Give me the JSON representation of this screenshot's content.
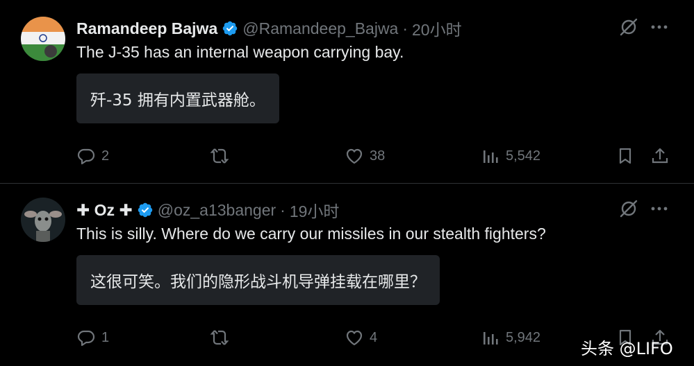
{
  "tweets": [
    {
      "name": "Ramandeep Bajwa",
      "handle": "@Ramandeep_Bajwa",
      "separator": "·",
      "time": "20小时",
      "text": "The J-35 has an internal weapon carrying bay.",
      "translation": "歼-35 拥有内置武器舱。",
      "replies": "2",
      "retweets": "",
      "likes": "38",
      "views": "5,542"
    },
    {
      "name": "✚ Oz ✚",
      "handle": "@oz_a13banger",
      "separator": "·",
      "time": "19小时",
      "text": "This is silly. Where do we carry our missiles in our stealth fighters?",
      "translation": "这很可笑。我们的隐形战斗机导弹挂载在哪里？",
      "replies": "1",
      "retweets": "",
      "likes": "4",
      "views": "5,942"
    }
  ],
  "watermark": "头条 @LIFO",
  "colors": {
    "background": "#000000",
    "text": "#e7e9ea",
    "muted": "#71767b",
    "verified": "#1d9bf0",
    "translation_bg": "#202327"
  },
  "icons": [
    "verified-badge-icon",
    "grok-slash-icon",
    "more-dots-icon",
    "reply-icon",
    "retweet-icon",
    "like-icon",
    "views-icon",
    "bookmark-icon",
    "share-icon"
  ]
}
